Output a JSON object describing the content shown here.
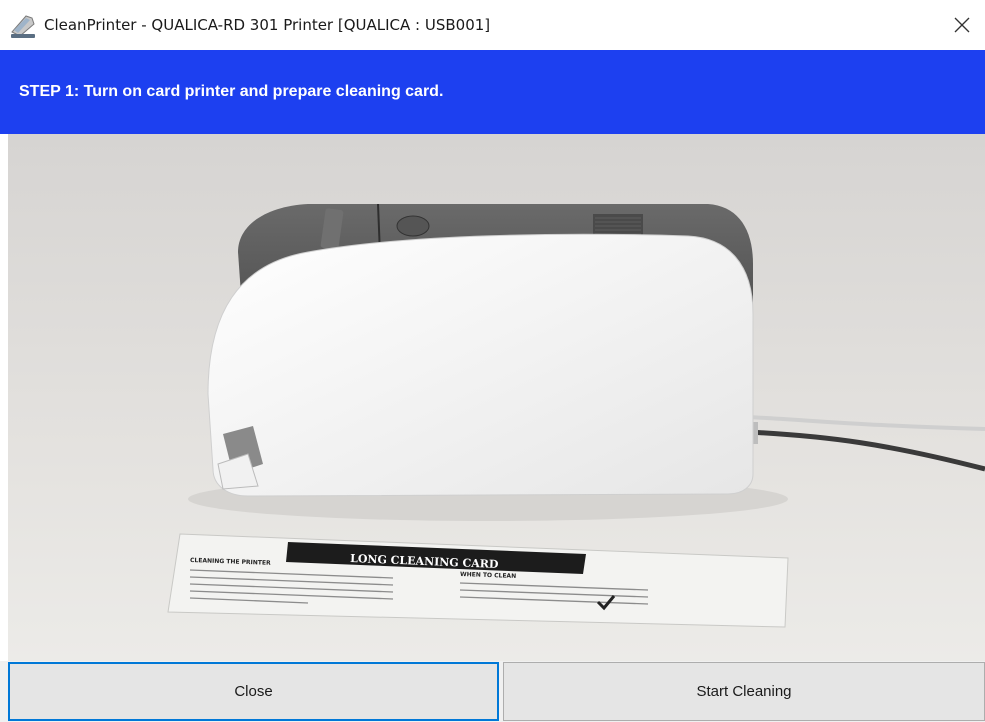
{
  "window": {
    "title": "CleanPrinter - QUALICA-RD 301 Printer [QUALICA : USB001]",
    "app_icon": "printer-clean-icon",
    "close_icon": "close-icon"
  },
  "step": {
    "text": "STEP 1:  Turn on card printer and prepare cleaning card."
  },
  "illustration": {
    "card_title": "LONG CLEANING CARD",
    "card_left_heading": "CLEANING THE PRINTER",
    "card_right_heading": "WHEN TO CLEAN"
  },
  "buttons": {
    "close_label": "Close",
    "start_label": "Start Cleaning"
  },
  "colors": {
    "banner": "#1d40f0",
    "focus_border": "#0078d7"
  }
}
